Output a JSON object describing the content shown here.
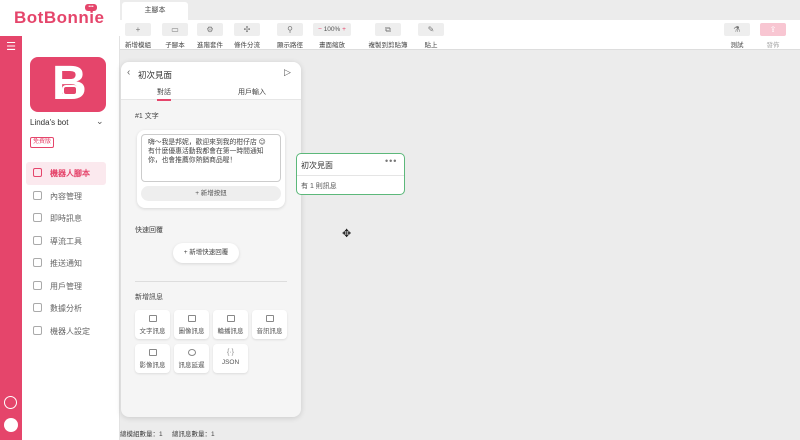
{
  "brand": {
    "name": "BotBonnie",
    "logo_badge": "•••"
  },
  "sidebar": {
    "bot_name": "Linda's bot",
    "plan_badge": "免費版",
    "items": [
      {
        "label": "機器人腳本",
        "icon": "robot-script-icon",
        "active": true
      },
      {
        "label": "內容管理",
        "icon": "content-icon"
      },
      {
        "label": "即時訊息",
        "icon": "chat-icon"
      },
      {
        "label": "導流工具",
        "icon": "magnet-icon"
      },
      {
        "label": "推送通知",
        "icon": "megaphone-icon"
      },
      {
        "label": "用戶管理",
        "icon": "users-icon"
      },
      {
        "label": "數據分析",
        "icon": "chart-icon"
      },
      {
        "label": "機器人設定",
        "icon": "gear-icon"
      }
    ]
  },
  "tabs": {
    "main": "主腳本"
  },
  "toolbar": {
    "new_module": "新增模組",
    "sub_script": "子腳本",
    "advanced_kit": "進階套件",
    "condition_split": "條件分流",
    "show_path": "顯示路徑",
    "zoom_value": "100%",
    "zoom_label": "畫面縮放",
    "copy_clipboard": "複製到剪貼簿",
    "paste": "貼上",
    "test": "測試",
    "publish": "發佈"
  },
  "panel": {
    "title": "初次見面",
    "tab_dialog": "對話",
    "tab_user_input": "用戶輸入",
    "section_text": "#1 文字",
    "message": "嗨～我是邦妮，歡迎來到我的柑仔店 😉 有什麼優惠活動我都會在第一時間通知你，也會推薦你熱銷商品喔！",
    "add_button": "+ 新增按鈕",
    "quick_reply_label": "快速回覆",
    "add_quick_reply": "+ 新增快速回覆",
    "new_message_label": "新增訊息",
    "message_types": [
      "文字訊息",
      "圖像訊息",
      "輪播訊息",
      "音訊訊息",
      "影像訊息",
      "訊息延遲",
      "JSON"
    ]
  },
  "node": {
    "title": "初次見面",
    "subtitle": "有 1 則訊息",
    "menu": "•••"
  },
  "status": {
    "module_count": "總模組數量：1",
    "message_count": "總訊息數量：1"
  },
  "colors": {
    "accent": "#e5456b",
    "node_border": "#5cb87a"
  }
}
